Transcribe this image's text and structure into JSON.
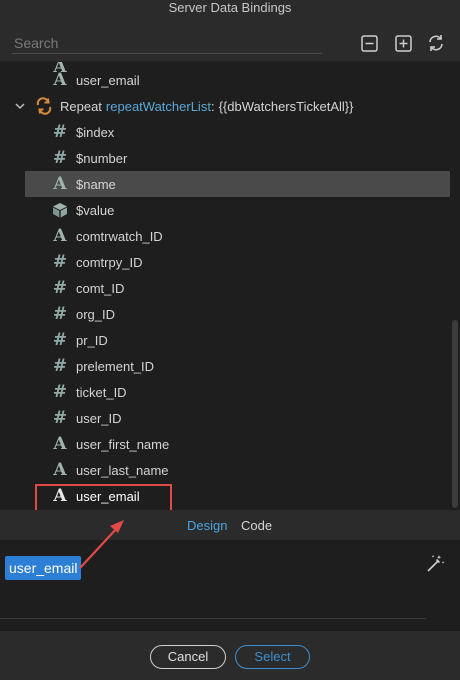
{
  "window": {
    "title": "Server Data Bindings"
  },
  "toolbar": {
    "search_placeholder": "Search"
  },
  "tree": {
    "top_item": {
      "icon": "text-type-icon",
      "label": "user_email"
    },
    "repeat": {
      "prefix": "Repeat",
      "name": "repeatWatcherList",
      "colon": ":",
      "binding": "{{dbWatchersTicketAll}}"
    },
    "children": [
      {
        "icon": "number-type-icon",
        "label": "$index"
      },
      {
        "icon": "number-type-icon",
        "label": "$number"
      },
      {
        "icon": "text-type-icon",
        "label": "$name"
      },
      {
        "icon": "object-type-icon",
        "label": "$value"
      },
      {
        "icon": "text-type-icon",
        "label": "comtrwatch_ID"
      },
      {
        "icon": "number-type-icon",
        "label": "comtrpy_ID"
      },
      {
        "icon": "number-type-icon",
        "label": "comt_ID"
      },
      {
        "icon": "number-type-icon",
        "label": "org_ID"
      },
      {
        "icon": "number-type-icon",
        "label": "pr_ID"
      },
      {
        "icon": "number-type-icon",
        "label": "prelement_ID"
      },
      {
        "icon": "number-type-icon",
        "label": "ticket_ID"
      },
      {
        "icon": "number-type-icon",
        "label": "user_ID"
      },
      {
        "icon": "text-type-icon",
        "label": "user_first_name"
      },
      {
        "icon": "text-type-icon",
        "label": "user_last_name"
      },
      {
        "icon": "text-type-icon",
        "label": "user_email"
      }
    ]
  },
  "tabs": {
    "design": "Design",
    "code": "Code"
  },
  "editor": {
    "token": "user_email"
  },
  "buttons": {
    "cancel": "Cancel",
    "select": "Select"
  },
  "colors": {
    "accent": "#2d7fd6",
    "annotation": "#e24a4a",
    "selected_row": "#4a4a4a"
  }
}
